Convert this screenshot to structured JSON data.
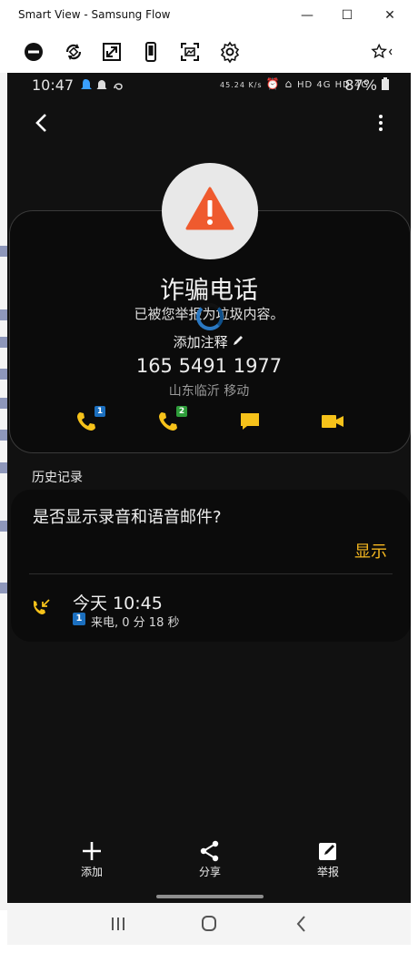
{
  "window": {
    "title": "Smart View - Samsung Flow",
    "minimize": "—",
    "maximize": "☐",
    "close": "✕"
  },
  "toolbar": {
    "icons": [
      "block-icon",
      "rotate-icon",
      "fullscreen-icon",
      "phone-icon",
      "screenshot-icon",
      "settings-icon",
      "favorite-icon"
    ]
  },
  "status_bar": {
    "time": "10:47",
    "net_speed": "45.24 K/s",
    "signal_text": "HD 4G HD 4G",
    "battery": "87%"
  },
  "contact": {
    "name": "诈骗电话",
    "spam_note": "已被您举报为垃圾内容。",
    "add_note": "添加注释",
    "number": "165 5491 1977",
    "location": "山东临沂 移动"
  },
  "actions": {
    "sim1_badge": "1",
    "sim2_badge": "2"
  },
  "history": {
    "label": "历史记录",
    "question": "是否显示录音和语音邮件?",
    "show_button": "显示",
    "call_time": "今天 10:45",
    "sim_badge": "1",
    "call_detail": "来电, 0 分 18 秒"
  },
  "bottom_bar": {
    "add": "添加",
    "share": "分享",
    "report": "举报"
  },
  "colors": {
    "accent": "#f6b820",
    "warning": "#ef5a2e",
    "sim1": "#1b6fbf",
    "sim2": "#2e9d3a",
    "background": "#111111"
  }
}
